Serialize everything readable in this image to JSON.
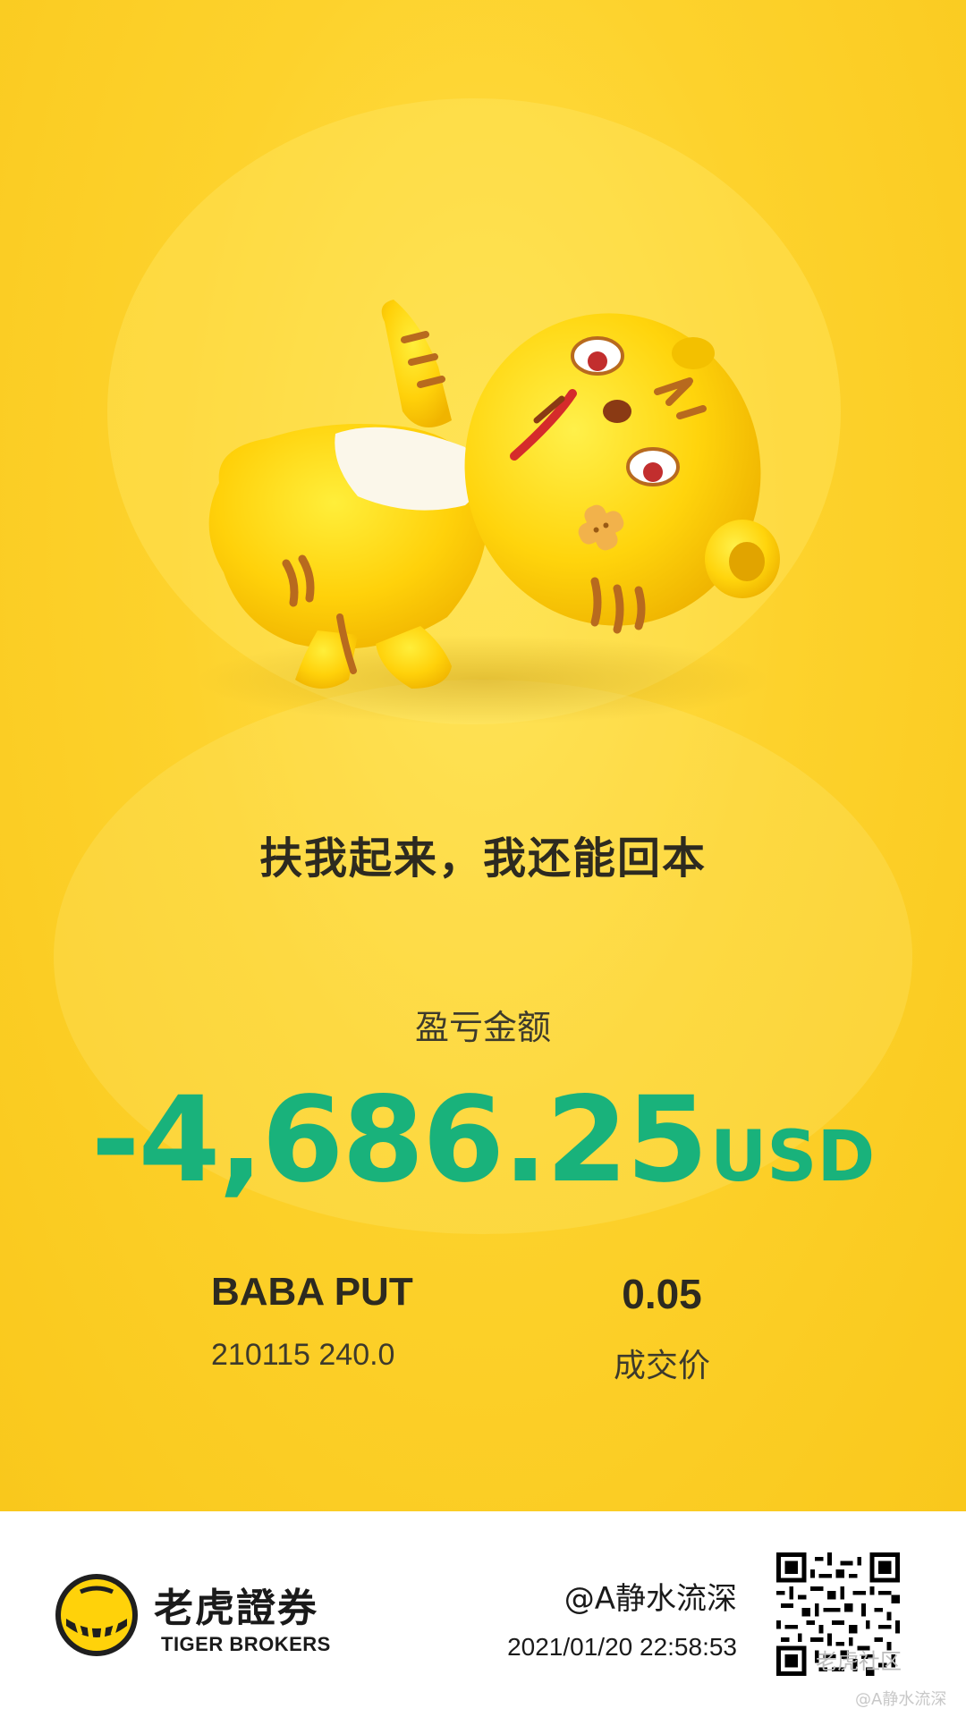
{
  "card": {
    "headline": "扶我起来，我还能回本",
    "pnl_label": "盈亏金额",
    "pnl_value": "-4,686.25",
    "pnl_currency": "USD",
    "contract_name": "BABA PUT",
    "contract_detail": "210115 240.0",
    "price_value": "0.05",
    "price_label": "成交价",
    "colors": {
      "background": "#fdd22c",
      "loss_green": "#19b27b",
      "text_dark": "#2d2a20"
    },
    "mascot": "tiger-mascot-lying-down"
  },
  "footer": {
    "brand_cn": "老虎證券",
    "brand_en": "TIGER BROKERS",
    "user_handle": "@A静水流深",
    "timestamp": "2021/01/20 22:58:53",
    "watermark": "老虎社区",
    "watermark_handle": "@A静水流深"
  }
}
